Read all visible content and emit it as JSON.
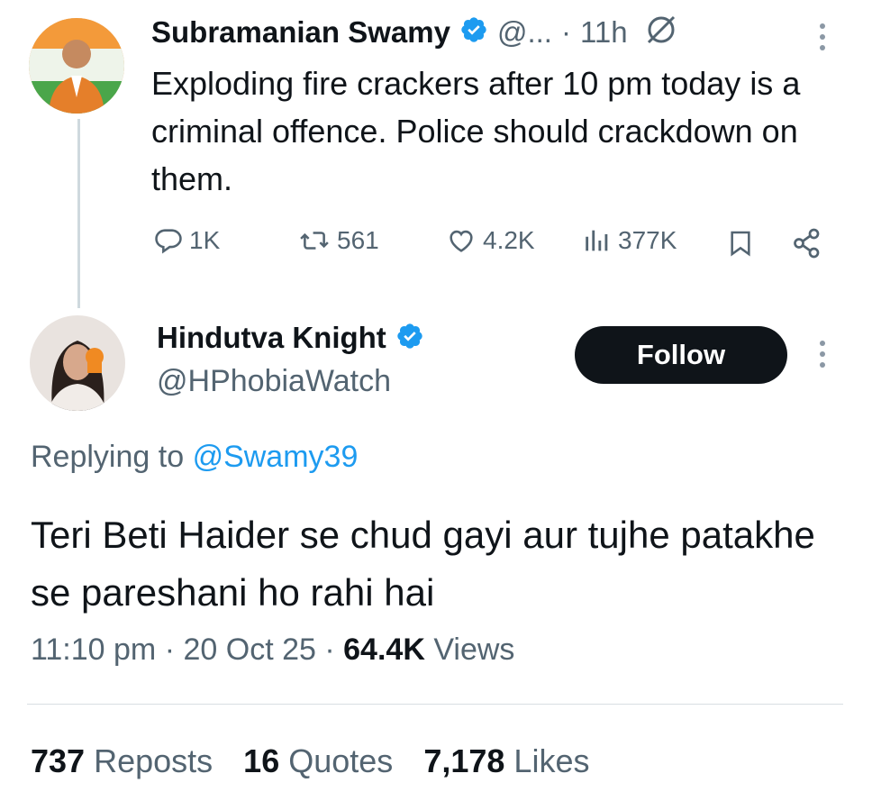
{
  "original_tweet": {
    "name": "Subramanian Swamy",
    "handle": "@...",
    "separator": "·",
    "time": "11h",
    "text": "Exploding fire crackers after 10 pm today is a criminal offence. Police should crackdown on them.",
    "actions": {
      "replies": "1K",
      "reposts": "561",
      "likes": "4.2K",
      "views": "377K"
    }
  },
  "reply_tweet": {
    "name": "Hindutva Knight",
    "handle": "@HPhobiaWatch",
    "follow_label": "Follow",
    "replying_prefix": "Replying to",
    "replying_handle": "@Swamy39",
    "text": "Teri Beti Haider se chud gayi aur tujhe patakhe se pareshani ho rahi hai",
    "time": "11:10 pm",
    "sep1": "·",
    "date": "20 Oct 25",
    "sep2": "·",
    "views_count": "64.4K",
    "views_label": "Views"
  },
  "engagement": {
    "reposts_count": "737",
    "reposts_label": "Reposts",
    "quotes_count": "16",
    "quotes_label": "Quotes",
    "likes_count": "7,178",
    "likes_label": "Likes"
  },
  "colors": {
    "text": "#0f1419",
    "muted": "#536471",
    "link": "#1d9bf0",
    "verified": "#1d9bf0",
    "button_bg": "#0f1419"
  },
  "icons": [
    "verified-badge-icon",
    "grok-icon",
    "more-icon",
    "reply-icon",
    "repost-icon",
    "like-icon",
    "views-icon",
    "bookmark-icon",
    "share-icon"
  ]
}
